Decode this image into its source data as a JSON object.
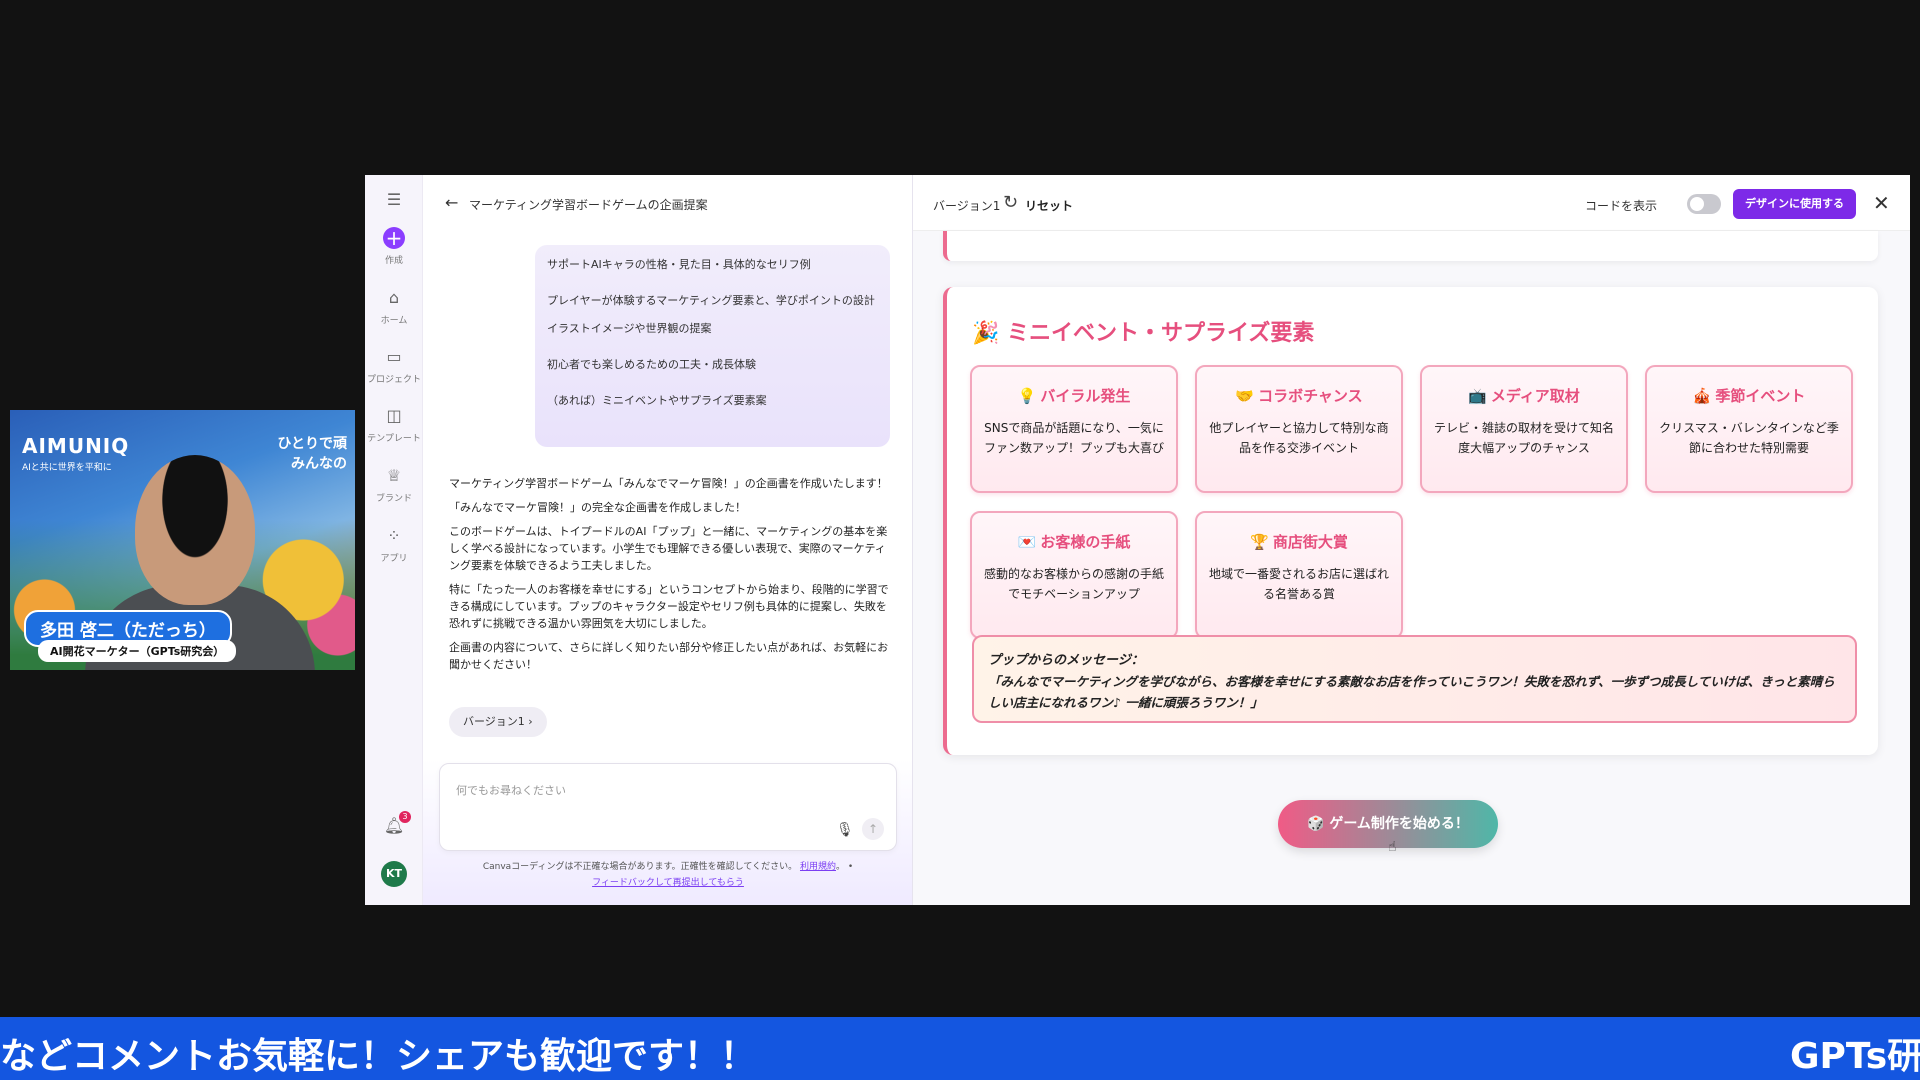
{
  "webcam": {
    "logo": "AIMUNIQ",
    "logo_sub": "AIと共に世界を平和に",
    "slogan_line1": "ひとりで頑",
    "slogan_line2": "みんなの",
    "name": "多田 啓二（ただっち）",
    "role": "AI開花マーケター（GPTs研究会）"
  },
  "rail": {
    "items": [
      {
        "label": "作成",
        "icon": "plus-icon"
      },
      {
        "label": "ホーム",
        "icon": "home-icon"
      },
      {
        "label": "プロジェクト",
        "icon": "folder-icon"
      },
      {
        "label": "テンプレート",
        "icon": "template-icon"
      },
      {
        "label": "ブランド",
        "icon": "brand-icon"
      },
      {
        "label": "アプリ",
        "icon": "apps-icon"
      }
    ],
    "notification_count": "3",
    "avatar_initials": "KT"
  },
  "chat": {
    "title": "マーケティング学習ボードゲームの企画提案",
    "user_lines": [
      "サポートAIキャラの性格・見た目・具体的なセリフ例",
      "プレイヤーが体験するマーケティング要素と、学びポイントの設計",
      "イラストイメージや世界観の提案",
      "初心者でも楽しめるための工夫・成長体験",
      "（あれば）ミニイベントやサプライズ要素案"
    ],
    "ai_paragraphs": [
      "マーケティング学習ボードゲーム「みんなでマーケ冒険！」の企画書を作成いたします！",
      "「みんなでマーケ冒険！」の完全な企画書を作成しました！",
      "このボードゲームは、トイプードルのAI「プップ」と一緒に、マーケティングの基本を楽しく学べる設計になっています。小学生でも理解できる優しい表現で、実際のマーケティング要素を体験できるよう工夫しました。",
      "特に「たった一人のお客様を幸せにする」というコンセプトから始まり、段階的に学習できる構成にしています。プップのキャラクター設定やセリフ例も具体的に提案し、失敗を恐れずに挑戦できる温かい雰囲気を大切にしました。",
      "企画書の内容について、さらに詳しく知りたい部分や修正したい点があれば、お気軽にお聞かせください！"
    ],
    "version_chip": "バージョン1 ›",
    "input_placeholder": "何でもお尋ねください",
    "disclaimer_text": "Canvaコーディングは不正確な場合があります。正確性を確認してください。",
    "disclaimer_link1": "利用規約",
    "disclaimer_link2": "フィードバックして再提出してもらう"
  },
  "preview": {
    "version": "バージョン1",
    "reset": "リセット",
    "code_label": "コードを表示",
    "use_button": "デザインに使用する",
    "section_title": "🎉 ミニイベント・サプライズ要素",
    "tiles": [
      {
        "emoji": "💡",
        "title": "バイラル発生",
        "desc": "SNSで商品が話題になり、一気にファン数アップ！プップも大喜び"
      },
      {
        "emoji": "🤝",
        "title": "コラボチャンス",
        "desc": "他プレイヤーと協力して特別な商品を作る交渉イベント"
      },
      {
        "emoji": "📺",
        "title": "メディア取材",
        "desc": "テレビ・雑誌の取材を受けて知名度大幅アップのチャンス"
      },
      {
        "emoji": "🎪",
        "title": "季節イベント",
        "desc": "クリスマス・バレンタインなど季節に合わせた特別需要"
      },
      {
        "emoji": "💌",
        "title": "お客様の手紙",
        "desc": "感動的なお客様からの感謝の手紙でモチベーションアップ"
      },
      {
        "emoji": "🏆",
        "title": "商店街大賞",
        "desc": "地域で一番愛されるお店に選ばれる名誉ある賞"
      }
    ],
    "message_title": "プップからのメッセージ：",
    "message_body": "「みんなでマーケティングを学びながら、お客様を幸せにする素敵なお店を作っていこうワン！失敗を恐れず、一歩ずつ成長していけば、きっと素晴らしい店主になれるワン♪ 一緒に頑張ろうワン！」",
    "start_button": "🎲 ゲーム制作を始める！"
  },
  "ticker": {
    "message": "などコメントお気軽に！シェアも歓迎です！！",
    "brand": "GPTs研"
  }
}
